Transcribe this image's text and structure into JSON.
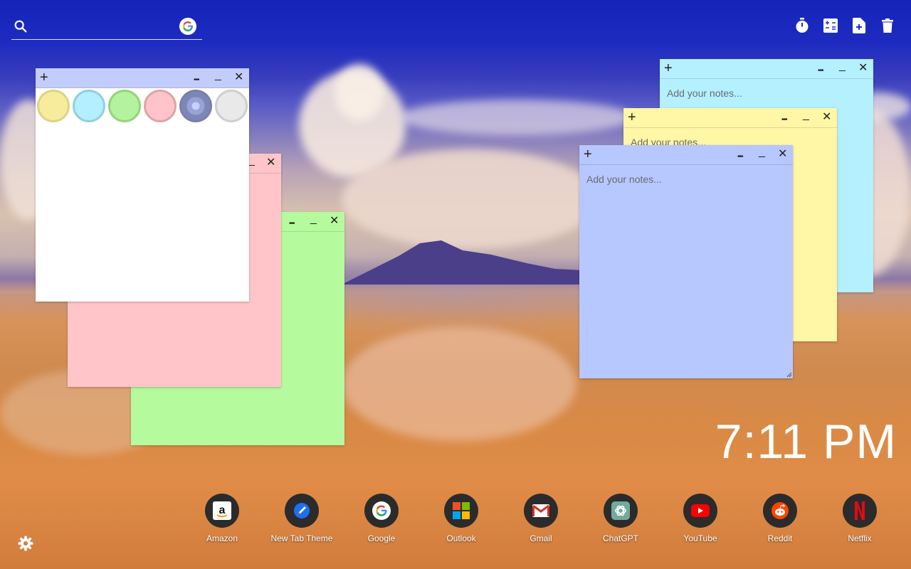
{
  "search": {
    "placeholder": "",
    "value": "",
    "icon": "search-icon",
    "engine_icon": "google-icon"
  },
  "tools": [
    {
      "name": "timer-icon"
    },
    {
      "name": "calculator-icon"
    },
    {
      "name": "new-note-icon"
    },
    {
      "name": "trash-icon"
    }
  ],
  "notes": {
    "plus": "+",
    "more": "•••",
    "minimize": "_",
    "close": "✕",
    "placeholder": "Add your notes..."
  },
  "palette": {
    "colors": [
      "#f7ec9c",
      "#b3efff",
      "#b5f29e",
      "#ffc4c9",
      "#7d86b8",
      "#e9e9e9"
    ]
  },
  "note_colors": {
    "white": "#ffffff",
    "pink": "#ffc5c8",
    "green": "#b5fb9e",
    "cyan": "#b5f0ff",
    "yellow": "#fff6a6",
    "blue": "#b7c7ff",
    "bar_blue": "#c3cdfb"
  },
  "clock": {
    "time": "7:11 PM"
  },
  "shortcuts": [
    {
      "label": "Amazon",
      "icon": "amazon-icon"
    },
    {
      "label": "New Tab Theme",
      "icon": "new-tab-theme-icon"
    },
    {
      "label": "Google",
      "icon": "google-icon"
    },
    {
      "label": "Outlook",
      "icon": "outlook-icon"
    },
    {
      "label": "Gmail",
      "icon": "gmail-icon"
    },
    {
      "label": "ChatGPT",
      "icon": "chatgpt-icon"
    },
    {
      "label": "YouTube",
      "icon": "youtube-icon"
    },
    {
      "label": "Reddit",
      "icon": "reddit-icon"
    },
    {
      "label": "Netflix",
      "icon": "netflix-icon"
    }
  ],
  "settings": {
    "icon": "gear-icon"
  }
}
